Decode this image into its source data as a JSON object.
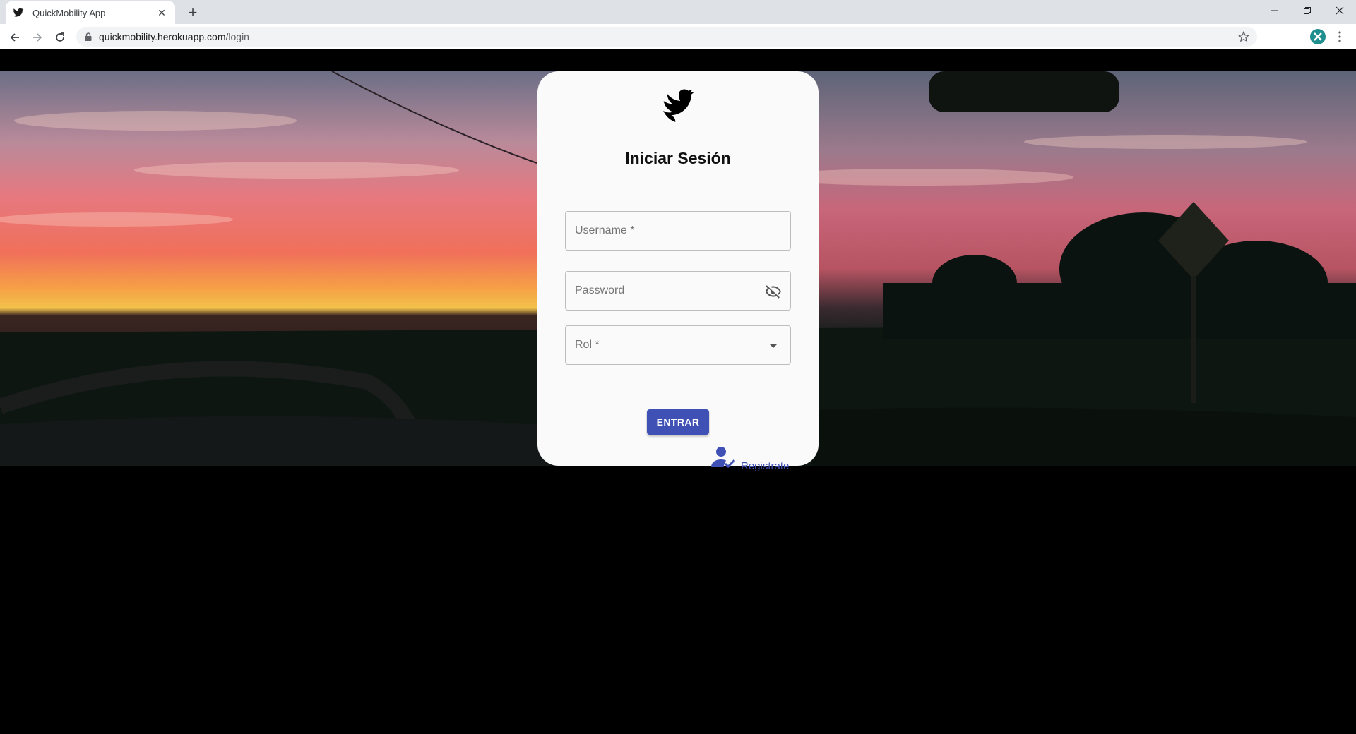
{
  "browser": {
    "tab_title": "QuickMobility App",
    "tab_close": "✕",
    "new_tab": "+",
    "url_host": "quickmobility.herokuapp.com",
    "url_path": "/login"
  },
  "login": {
    "heading": "Iniciar Sesión",
    "username_label": "Username *",
    "password_label": "Password",
    "rol_label": "Rol *",
    "submit_label": "ENTRAR",
    "register_label": "Registrate"
  },
  "colors": {
    "primary": "#3f51b5",
    "card_bg": "#fafafa"
  },
  "icons": {
    "logo": "twitter-bird-icon",
    "password_toggle": "visibility-off-icon",
    "rol_dropdown": "arrow-drop-down-icon",
    "register": "person-check-icon"
  }
}
